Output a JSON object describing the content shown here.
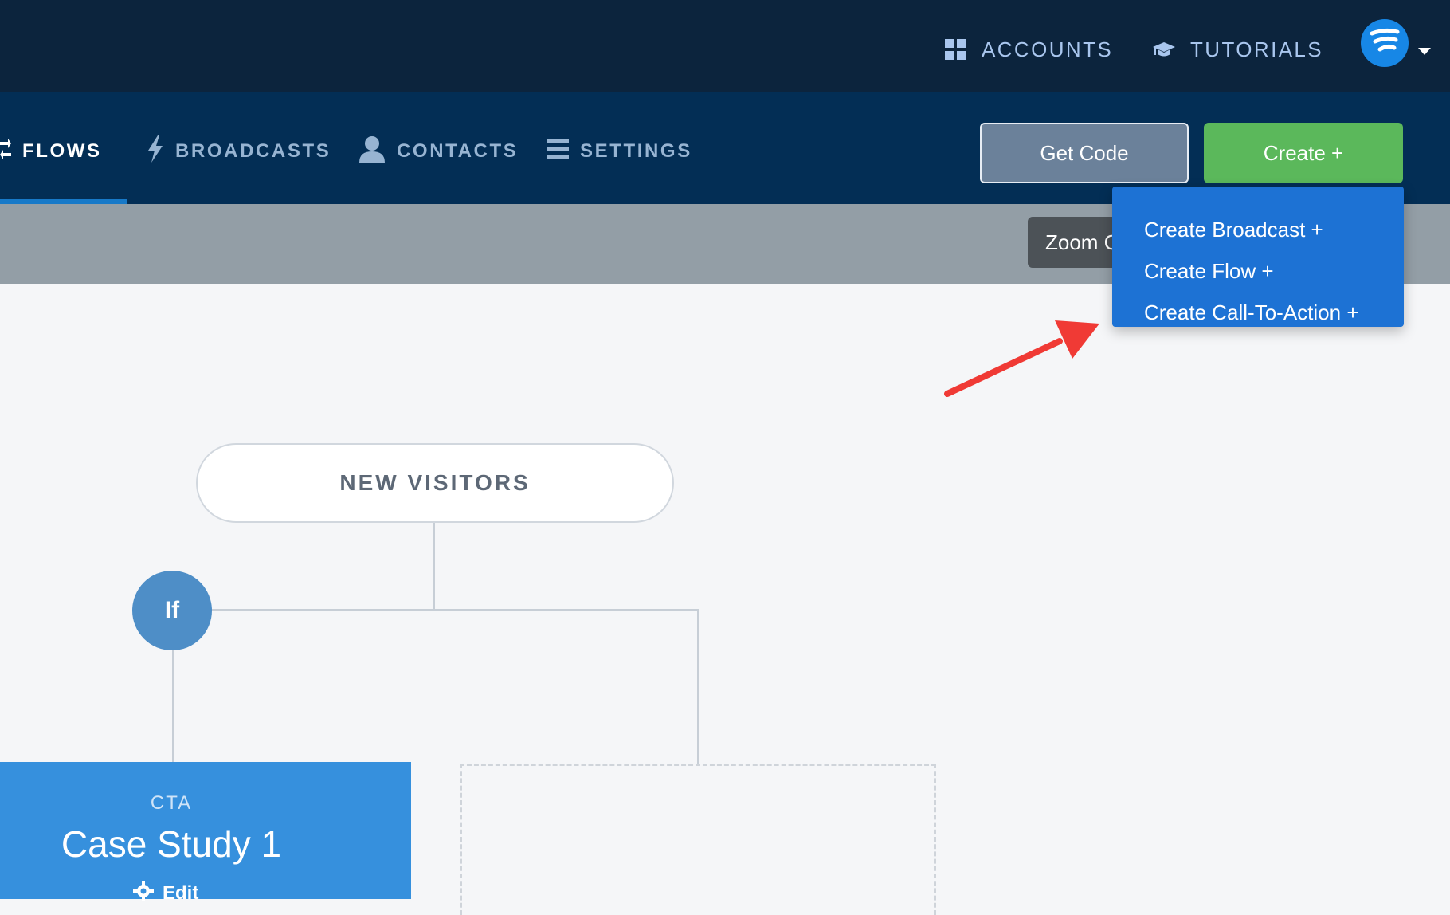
{
  "topbar": {
    "accounts_label": "ACCOUNTS",
    "tutorials_label": "TUTORIALS",
    "accounts_icon": "grid-icon",
    "tutorials_icon": "graduation-cap-icon",
    "avatar_icon": "brand-logo-icon"
  },
  "nav": {
    "items": [
      {
        "label": "FLOWS",
        "icon": "flows-icon",
        "active": true
      },
      {
        "label": "BROADCASTS",
        "icon": "lightning-icon",
        "active": false
      },
      {
        "label": "CONTACTS",
        "icon": "user-icon",
        "active": false
      },
      {
        "label": "SETTINGS",
        "icon": "menu-icon",
        "active": false
      }
    ],
    "get_code_label": "Get Code",
    "create_label": "Create +"
  },
  "toolbar": {
    "zoom_label": "Zoom C"
  },
  "dropdown": {
    "items": [
      {
        "label": "Create Broadcast +"
      },
      {
        "label": "Create Flow +"
      },
      {
        "label": "Create Call-To-Action +"
      }
    ]
  },
  "canvas": {
    "start_node_label": "NEW VISITORS",
    "if_label": "If",
    "cta_card": {
      "type_label": "CTA",
      "title": "Case Study 1",
      "edit_label": "Edit"
    }
  },
  "colors": {
    "topbar_bg": "#0c243d",
    "navbar_bg": "#032e55",
    "create_green": "#5bb85b",
    "dropdown_blue": "#1d72d4",
    "annotation_red": "#f03a35",
    "cta_blue": "#3690dd"
  }
}
